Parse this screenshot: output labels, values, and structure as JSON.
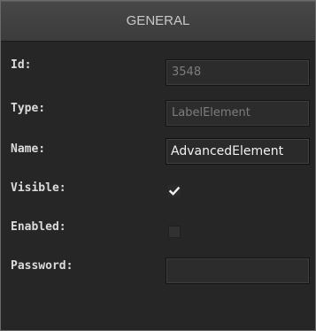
{
  "panel": {
    "title": "GENERAL"
  },
  "properties": {
    "id": {
      "label": "Id:",
      "value": "3548"
    },
    "type": {
      "label": "Type:",
      "value": "LabelElement"
    },
    "name": {
      "label": "Name:",
      "value": "AdvancedElement"
    },
    "visible": {
      "label": "Visible:",
      "checked": true
    },
    "enabled": {
      "label": "Enabled:",
      "checked": false
    },
    "password": {
      "label": "Password:",
      "value": ""
    }
  },
  "icons": {
    "visible_check": "checkmark-icon"
  },
  "colors": {
    "panel_background": "#262626",
    "header_background": "#434343",
    "label_text": "#dcdcdc",
    "disabled_value_text": "#7d7d7d",
    "active_value_text": "#f2f2f2"
  }
}
